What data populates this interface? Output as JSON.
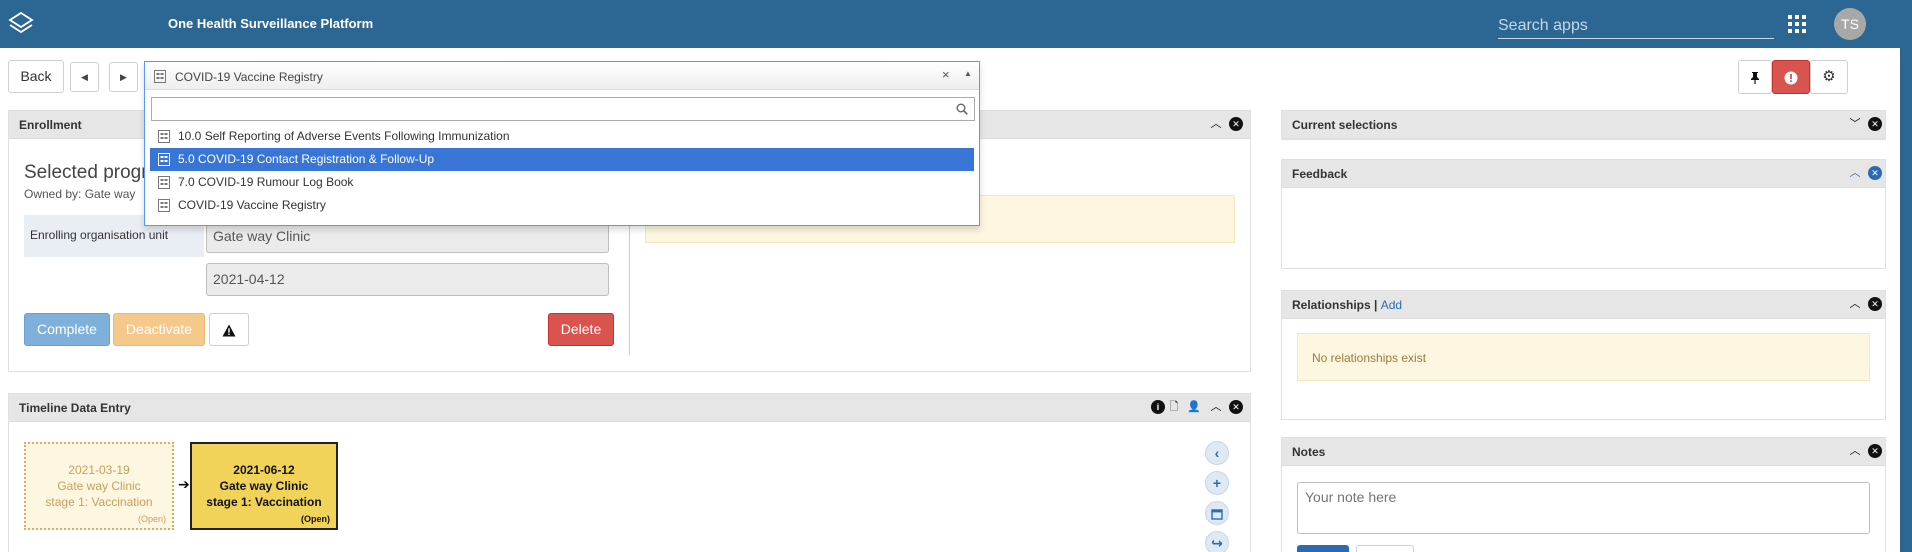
{
  "header": {
    "app_title": "One Health Surveillance Platform",
    "search_placeholder": "Search apps",
    "avatar_initials": "TS",
    "bar_color": "#2c6693"
  },
  "toolbar": {
    "back_label": "Back",
    "prev_icon": "caret-left-icon",
    "next_icon": "caret-right-icon",
    "right_icons": [
      "pin-icon",
      "exclamation-icon",
      "gear-icon"
    ]
  },
  "program_select": {
    "selected": "COVID-19 Vaccine Registry",
    "search_value": "",
    "options": [
      {
        "label": "10.0 Self Reporting of Adverse Events Following Immunization",
        "selected": false
      },
      {
        "label": "5.0 COVID-19 Contact Registration & Follow-Up",
        "selected": true
      },
      {
        "label": "7.0 COVID-19 Rumour Log Book",
        "selected": false
      },
      {
        "label": "COVID-19 Vaccine Registry",
        "selected": false
      }
    ]
  },
  "enrollment": {
    "title": "Enrollment",
    "selected_program_label": "Selected progr",
    "owned_by": "Owned by: Gate way",
    "org_unit_label": "Enrolling organisation unit",
    "org_unit_value": "Gate way Clinic",
    "date_value": "2021-04-12",
    "buttons": {
      "complete": "Complete",
      "deactivate": "Deactivate",
      "delete": "Delete"
    }
  },
  "timeline": {
    "title": "Timeline Data Entry",
    "events": [
      {
        "date": "2021-03-19",
        "org": "Gate way Clinic",
        "stage": "stage 1: Vaccination",
        "status": "(Open)"
      },
      {
        "date": "2021-06-12",
        "org": "Gate way Clinic",
        "stage": "stage 1: Vaccination",
        "status": "(Open)"
      }
    ],
    "controls": [
      "chevron-left-icon",
      "plus-icon",
      "calendar-icon",
      "share-icon"
    ]
  },
  "right_panel": {
    "current_selections_title": "Current selections",
    "feedback_title": "Feedback",
    "relationships_title": "Relationships | ",
    "relationships_add": "Add",
    "relationships_empty": "No relationships exist",
    "notes_title": "Notes",
    "notes_placeholder": "Your note here"
  }
}
